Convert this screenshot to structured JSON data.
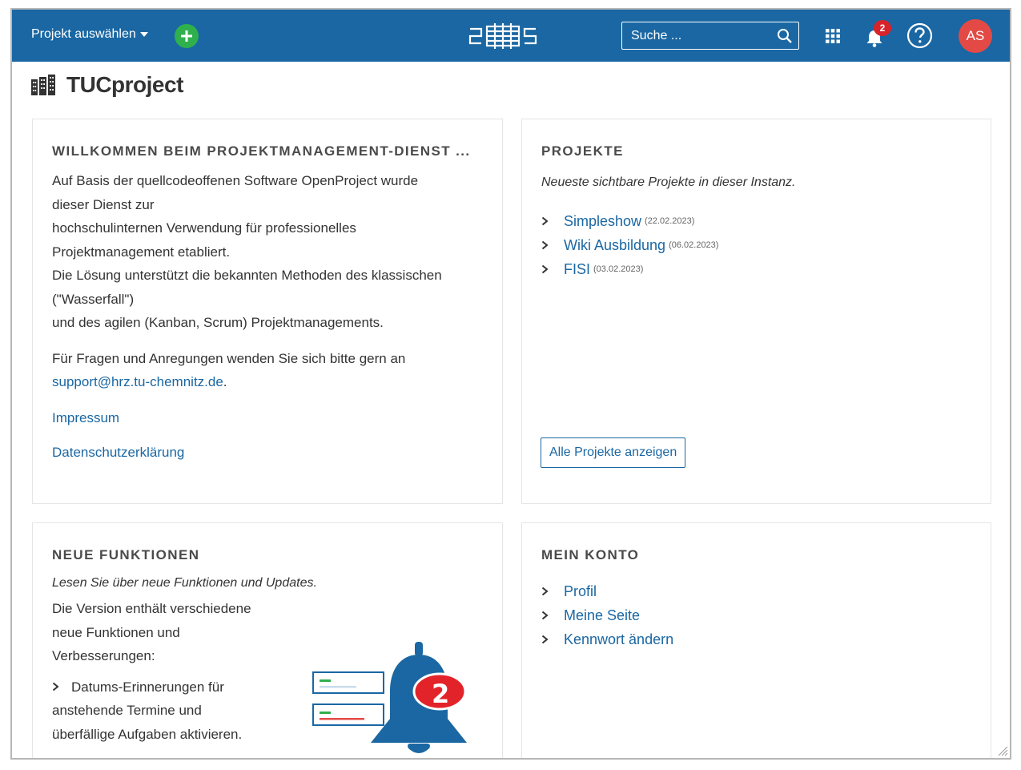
{
  "header": {
    "project_select_label": "Projekt auswählen",
    "search_placeholder": "Suche ...",
    "notification_count": "2",
    "avatar_initials": "AS",
    "brand_color": "#1a67a3",
    "add_button_color": "#2fb04d",
    "avatar_color": "#e34a45"
  },
  "page": {
    "title": "TUCproject",
    "title_icon": "building-icon"
  },
  "welcome": {
    "heading": "WILLKOMMEN BEIM PROJEKTMANAGEMENT-DIENST ...",
    "lines": [
      "Auf Basis der quellcodeoffenen Software OpenProject wurde",
      "dieser Dienst zur",
      "hochschulinternen Verwendung für professionelles",
      "Projektmanagement etabliert.",
      "Die Lösung unterstützt die bekannten Methoden des klassischen",
      "(\"Wasserfall\")",
      "und des agilen (Kanban, Scrum) Projektmanagements."
    ],
    "contact_text": "Für Fragen und Anregungen wenden Sie sich bitte gern an",
    "contact_email": "support@hrz.tu-chemnitz.de",
    "contact_suffix": ".",
    "impressum": "Impressum",
    "privacy": "Datenschutzerklärung"
  },
  "projects": {
    "heading": "PROJEKTE",
    "subtitle": "Neueste sichtbare Projekte in dieser Instanz.",
    "items": [
      {
        "name": "Simpleshow",
        "date": "(22.02.2023)"
      },
      {
        "name": "Wiki Ausbildung",
        "date": "(06.02.2023)"
      },
      {
        "name": "FISI",
        "date": "(03.02.2023)"
      }
    ],
    "all_button": "Alle Projekte anzeigen"
  },
  "news": {
    "heading": "NEUE FUNKTIONEN",
    "subtitle": "Lesen Sie über neue Funktionen und Updates.",
    "intro_lines": [
      "Die Version enthält verschiedene",
      "neue Funktionen und",
      "Verbesserungen:"
    ],
    "feature_lines": [
      "Datums-Erinnerungen für",
      "anstehende Termine und",
      "überfällige Aufgaben aktivieren."
    ],
    "illustration_badge": "2"
  },
  "account": {
    "heading": "MEIN KONTO",
    "items": [
      "Profil",
      "Meine Seite",
      "Kennwort ändern"
    ]
  }
}
